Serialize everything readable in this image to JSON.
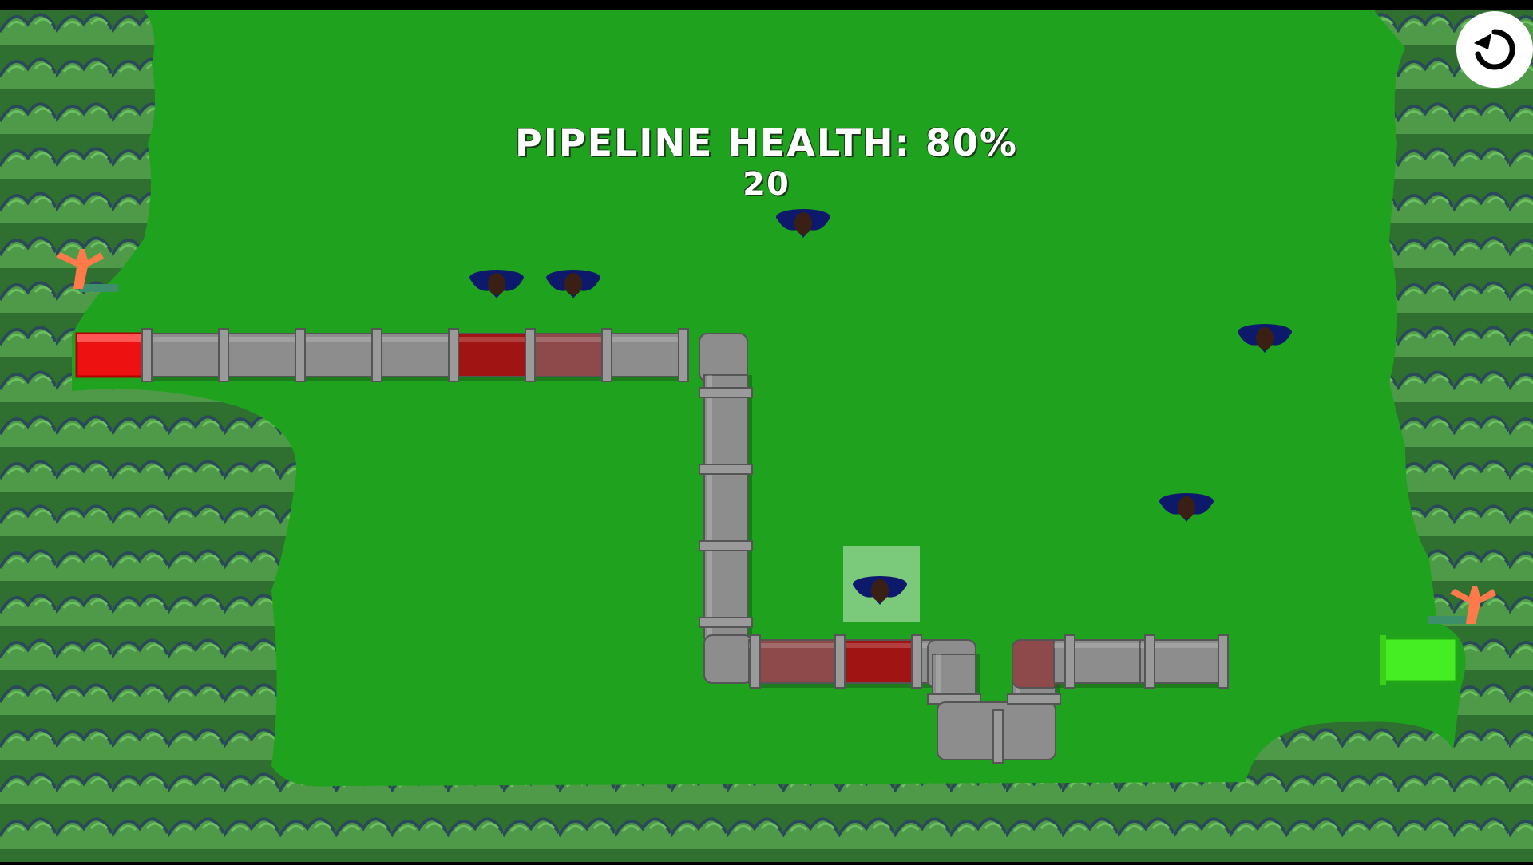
{
  "hud": {
    "health_text": "PIPELINE HEALTH: 80%",
    "score": "20"
  },
  "game": {
    "pipeline_health": 0.8,
    "score_value": 20
  },
  "controls": {
    "restart_icon": "restart-icon"
  },
  "colors": {
    "grass": "#1fa31f",
    "pipe_gray": "#8d8d8d",
    "pipe_damaged": "#a11414",
    "pipe_damaged_light": "#8e4a4a",
    "source_red": "#ee1111",
    "sink_green": "#44ee22",
    "bird_blue": "#0d1a6b",
    "forest_dark": "#2c6b2c",
    "forest_light": "#4a9a44"
  }
}
